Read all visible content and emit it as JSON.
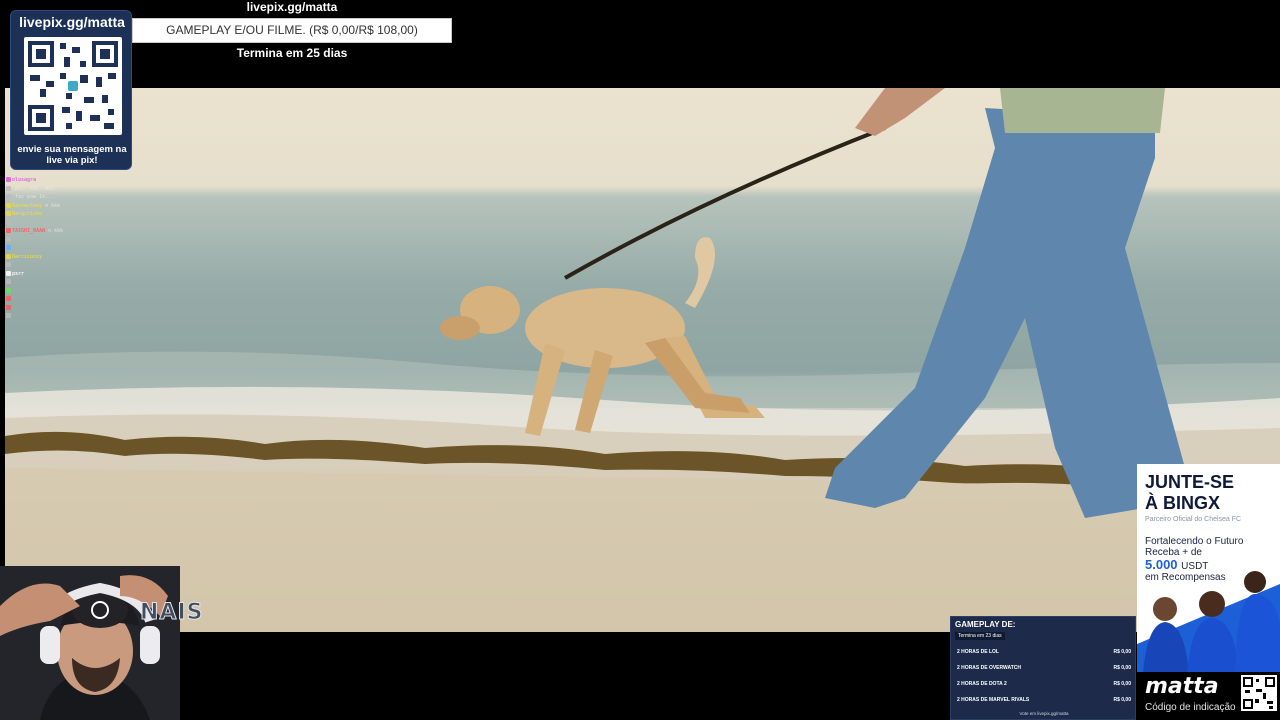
{
  "livepix": {
    "url": "livepix.gg/matta",
    "caption": "envie sua mensagem na live via pix!"
  },
  "goal": {
    "url": "livepix.gg/matta",
    "title": "GAMEPLAY E/OU FILME. (R$ 0,00/R$ 108,00)",
    "deadline": "Termina em 25 dias",
    "progress": 0.0
  },
  "chat": [
    {
      "user": "olusagra",
      "msg": "",
      "color": "#e05adf"
    },
    {
      "user": "",
      "msg": "ASC. ASC. ASC...",
      "color": "#bbbbbb"
    },
    {
      "user": "",
      "msg": "faz pow 1x...",
      "color": "#bbbbbb"
    },
    {
      "user": "Bacvectony",
      "msg": "n kkk",
      "color": "#e8d84a"
    },
    {
      "user": "Barqcricho",
      "msg": "",
      "color": "#e8d84a"
    },
    {
      "user": "",
      "msg": "",
      "color": "#bbbbbb"
    },
    {
      "user": "TAIGHI_RAAN",
      "msg": "n kkk",
      "color": "#ff5a5a"
    },
    {
      "user": "",
      "msg": "",
      "color": "#bbbbbb"
    },
    {
      "user": "",
      "msg": "",
      "color": "#6fa9ff"
    },
    {
      "user": "Barciinoxy",
      "msg": "",
      "color": "#e8d84a"
    },
    {
      "user": "",
      "msg": "",
      "color": "#bbbbbb"
    },
    {
      "user": "pxrr",
      "msg": "",
      "color": "#ffffff"
    },
    {
      "user": "",
      "msg": "",
      "color": "#bbbbbb"
    },
    {
      "user": "",
      "msg": "",
      "color": "#6fe05a"
    },
    {
      "user": "",
      "msg": "",
      "color": "#ff5a5a"
    },
    {
      "user": "",
      "msg": "",
      "color": "#ff5a5a"
    },
    {
      "user": "",
      "msg": "",
      "color": "#bbbbbb"
    }
  ],
  "webcam": {
    "banner_text": "NAIS"
  },
  "gameplay": {
    "title": "GAMEPLAY DE:",
    "deadline": "Termina em 23 dias",
    "rows": [
      {
        "label": "2 HORAS DE LOL",
        "price": "R$ 0,00"
      },
      {
        "label": "2 HORAS DE OVERWATCH",
        "price": "R$ 0,00"
      },
      {
        "label": "2 HORAS DE DOTA 2",
        "price": "R$ 0,00"
      },
      {
        "label": "2 HORAS DE MARVEL RIVALS",
        "price": "R$ 0,00"
      }
    ],
    "footer": "Vote em livepix.gg/matta"
  },
  "ad": {
    "headline_1": "JUNTE-SE",
    "headline_2": "À BINGX",
    "partner": "Parceiro Oficial do Chelsea FC",
    "line_1": "Fortalecendo o Futuro",
    "line_2": "Receba + de",
    "amount": "5.000",
    "currency": "USDT",
    "line_3": "em Recompensas",
    "accent": "#1d5fd6"
  },
  "brand": {
    "name": "matta",
    "subtitle": "Código de indicação"
  }
}
